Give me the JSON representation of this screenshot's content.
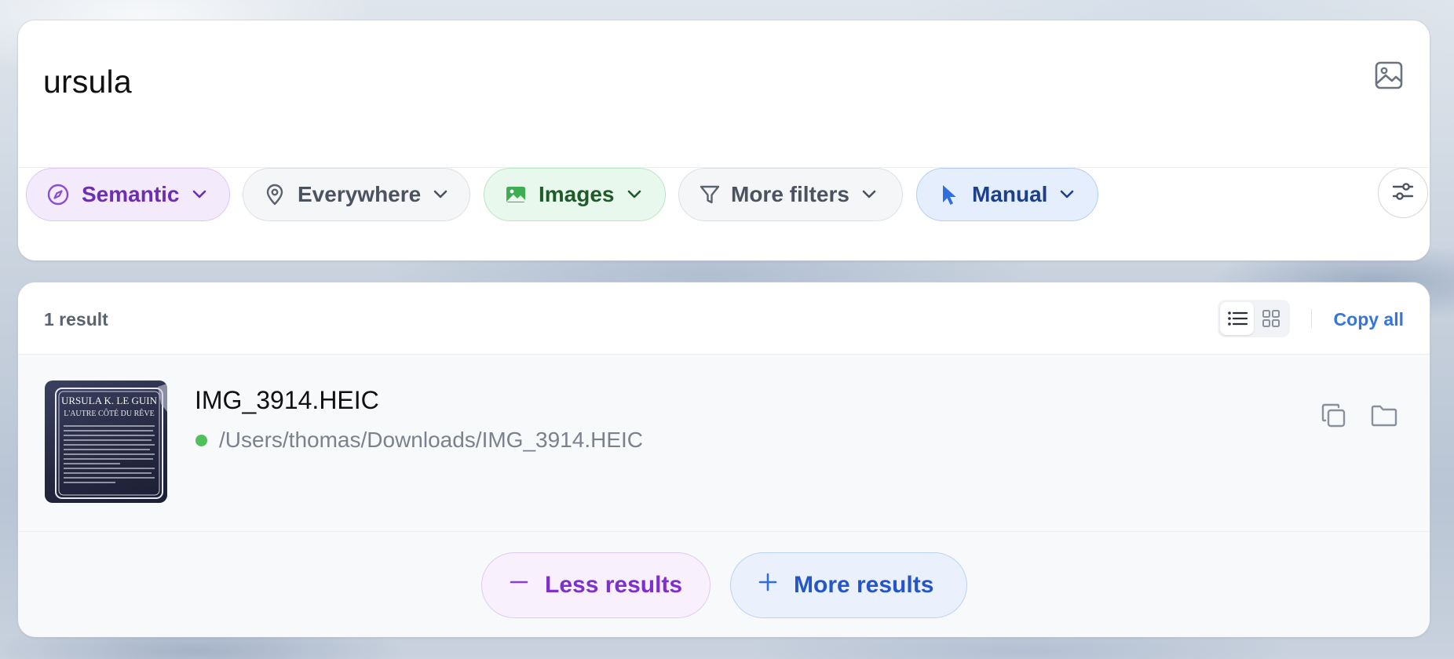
{
  "search": {
    "query": "ursula",
    "image_search_icon": "image-icon"
  },
  "filters": {
    "semantic": {
      "label": "Semantic",
      "icon": "compass-icon",
      "color": "#6b2fb0"
    },
    "location": {
      "label": "Everywhere",
      "icon": "location-pin-icon"
    },
    "type": {
      "label": "Images",
      "icon": "image-icon",
      "color": "#3fae52"
    },
    "more": {
      "label": "More filters",
      "icon": "funnel-icon"
    },
    "mode": {
      "label": "Manual",
      "icon": "cursor-icon",
      "color": "#2f6de0"
    },
    "settings_icon": "sliders-icon"
  },
  "results": {
    "count_label": "1 result",
    "copy_all_label": "Copy all",
    "view_modes": [
      "list",
      "grid"
    ],
    "active_view": "list",
    "items": [
      {
        "name": "IMG_3914.HEIC",
        "path": "/Users/thomas/Downloads/IMG_3914.HEIC",
        "status_color": "#4fc15a",
        "thumbnail": {
          "title": "URSULA K. LE GUIN",
          "subtitle": "L'AUTRE CÔTÉ DU RÊVE"
        }
      }
    ]
  },
  "pager": {
    "less_label": "Less results",
    "more_label": "More results"
  }
}
